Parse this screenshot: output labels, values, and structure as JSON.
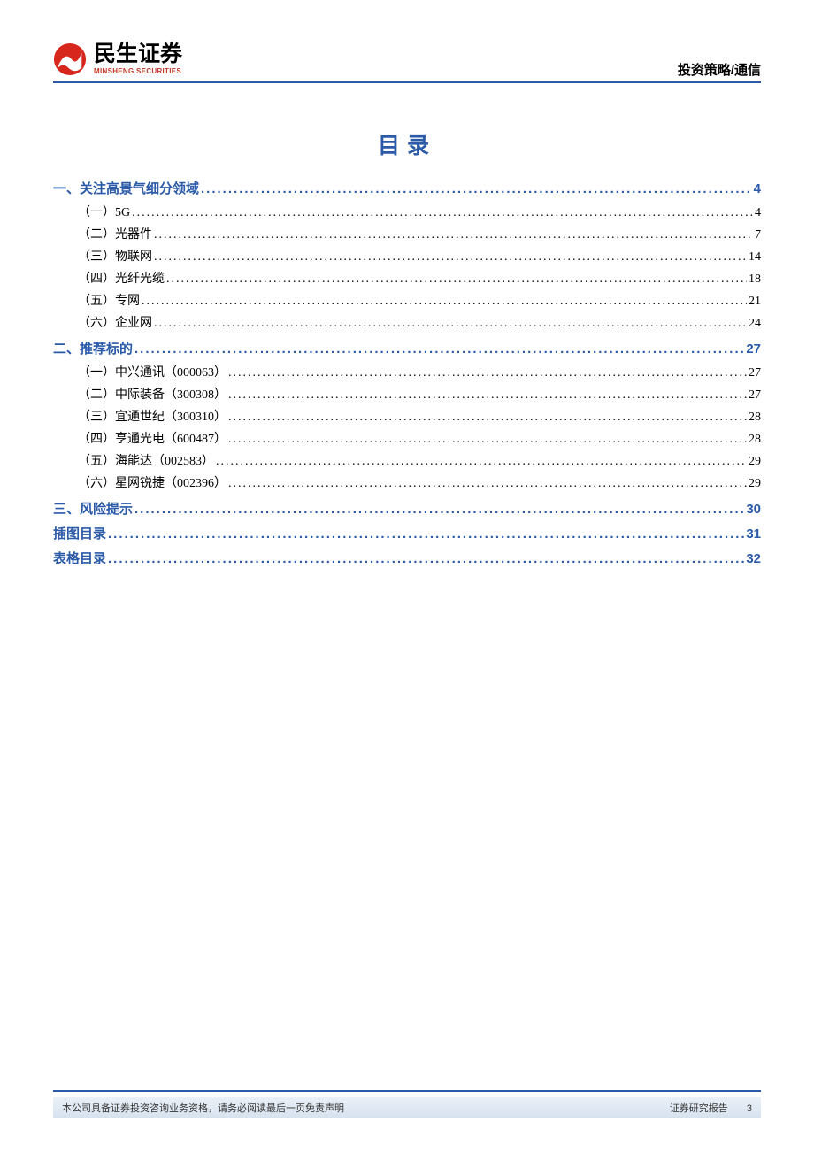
{
  "header": {
    "logo_cn": "民生证券",
    "logo_en": "MINSHENG SECURITIES",
    "category": "投资策略/通信"
  },
  "title": "目录",
  "toc": [
    {
      "level": 1,
      "label": "一、关注高景气细分领域 ",
      "page": "4"
    },
    {
      "level": 2,
      "label": "（一）5G",
      "page": "4"
    },
    {
      "level": 2,
      "label": "（二）光器件",
      "page": "7"
    },
    {
      "level": 2,
      "label": "（三）物联网",
      "page": "14"
    },
    {
      "level": 2,
      "label": "（四）光纤光缆",
      "page": "18"
    },
    {
      "level": 2,
      "label": "（五）专网",
      "page": "21"
    },
    {
      "level": 2,
      "label": "（六）企业网",
      "page": "24"
    },
    {
      "level": 1,
      "label": "二、推荐标的 ",
      "page": "27"
    },
    {
      "level": 2,
      "label": "（一）中兴通讯（000063）",
      "page": "27"
    },
    {
      "level": 2,
      "label": "（二）中际装备（300308）",
      "page": "27"
    },
    {
      "level": 2,
      "label": "（三）宜通世纪（300310）",
      "page": "28"
    },
    {
      "level": 2,
      "label": "（四）亨通光电（600487）",
      "page": "28"
    },
    {
      "level": 2,
      "label": "（五）海能达（002583）",
      "page": "29"
    },
    {
      "level": 2,
      "label": "（六）星网锐捷（002396）",
      "page": "29"
    },
    {
      "level": 1,
      "label": "三、风险提示 ",
      "page": "30"
    },
    {
      "level": 1,
      "label": "插图目录 ",
      "page": "31"
    },
    {
      "level": 1,
      "label": "表格目录 ",
      "page": "32"
    }
  ],
  "footer": {
    "disclaimer": "本公司具备证券投资咨询业务资格，请务必阅读最后一页免责声明",
    "report_type": "证券研究报告",
    "page_number": "3"
  }
}
